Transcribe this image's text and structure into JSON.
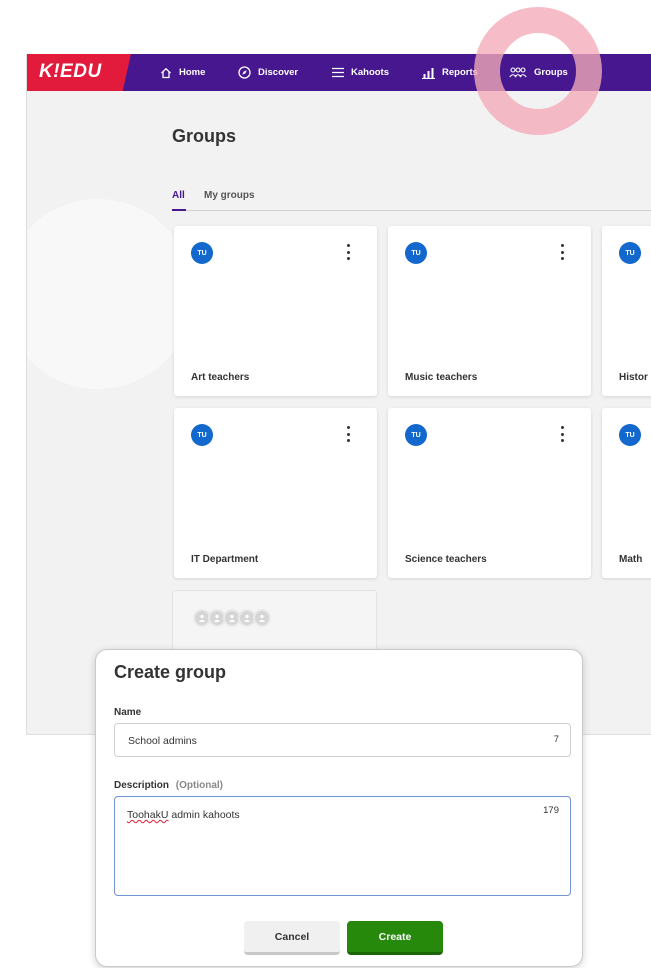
{
  "app": {
    "logo": "K!EDU",
    "nav": [
      {
        "label": "Home",
        "icon": "home-icon"
      },
      {
        "label": "Discover",
        "icon": "compass-icon"
      },
      {
        "label": "Kahoots",
        "icon": "list-icon"
      },
      {
        "label": "Reports",
        "icon": "bar-chart-icon"
      },
      {
        "label": "Groups",
        "icon": "people-icon",
        "active": true
      }
    ]
  },
  "page": {
    "title": "Groups",
    "tabs": [
      {
        "label": "All",
        "active": true
      },
      {
        "label": "My groups",
        "active": false
      }
    ]
  },
  "groups": [
    {
      "name": "Art teachers",
      "badge": "TU"
    },
    {
      "name": "Music teachers",
      "badge": "TU"
    },
    {
      "name": "Histor",
      "badge": "TU"
    },
    {
      "name": "IT Department",
      "badge": "TU"
    },
    {
      "name": "Science teachers",
      "badge": "TU"
    },
    {
      "name": "Math",
      "badge": "TU"
    }
  ],
  "modal": {
    "title": "Create group",
    "name_label": "Name",
    "name_value": "School admins",
    "name_counter": "7",
    "description_label": "Description",
    "description_optional": "(Optional)",
    "description_value_misspelled": "ToohakU",
    "description_value_rest": " admin kahoots",
    "description_counter": "179",
    "cancel_label": "Cancel",
    "create_label": "Create"
  },
  "colors": {
    "brand_red": "#e21b3c",
    "nav_purple": "#46178f",
    "badge_blue": "#1368ce",
    "create_green": "#26890c",
    "highlight_pink": "#f4aab9"
  }
}
